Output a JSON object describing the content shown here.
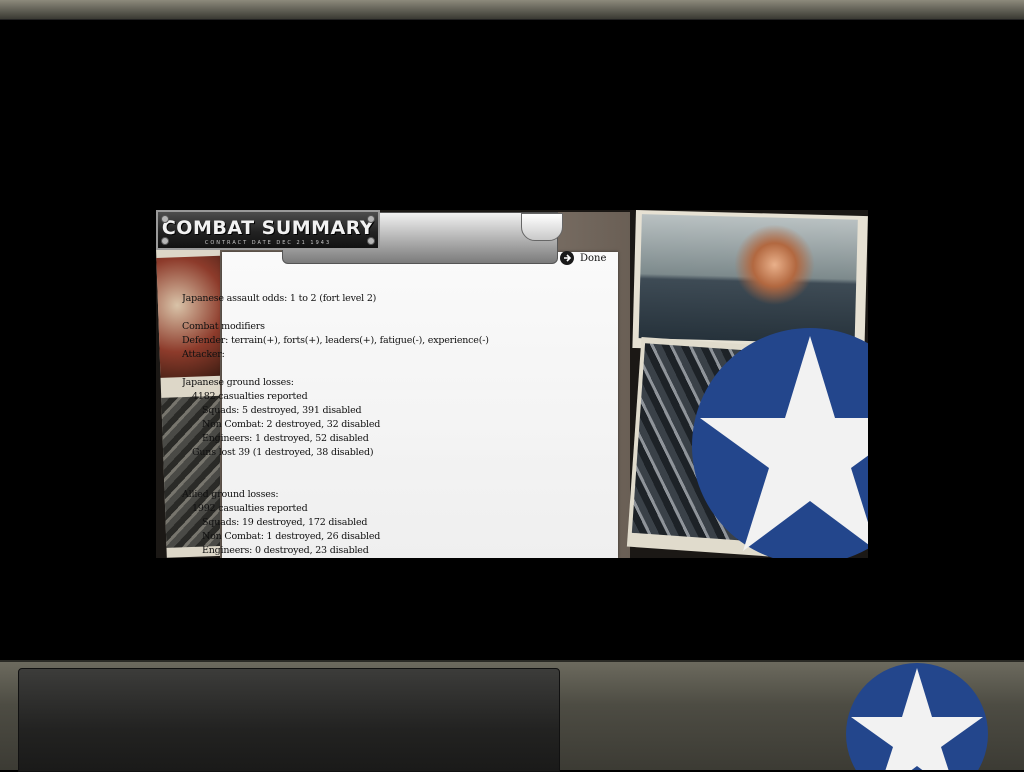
{
  "window": {
    "title": "COMBAT SUMMARY",
    "subtitle": "CONTRACT DATE  DEC  21  1943"
  },
  "toolbar": {
    "done_label": "Done",
    "done_icon": "arrow-right-circle-icon"
  },
  "report": {
    "lines": [
      {
        "text": "Japanese assault odds: 1 to 2 (fort level 2)",
        "indent": 0
      },
      {
        "text": "",
        "indent": 0
      },
      {
        "text": "Combat modifiers",
        "indent": 0
      },
      {
        "text": "Defender: terrain(+), forts(+), leaders(+), fatigue(-), experience(-)",
        "indent": 0
      },
      {
        "text": "Attacker:",
        "indent": 0
      },
      {
        "text": "",
        "indent": 0
      },
      {
        "text": "Japanese ground losses:",
        "indent": 0
      },
      {
        "text": "4182 casualties reported",
        "indent": 1
      },
      {
        "text": "Squads: 5 destroyed, 391 disabled",
        "indent": 2
      },
      {
        "text": "Non Combat: 2 destroyed, 32 disabled",
        "indent": 2
      },
      {
        "text": "Engineers: 1 destroyed, 52 disabled",
        "indent": 2
      },
      {
        "text": "Guns lost 39 (1 destroyed, 38 disabled)",
        "indent": 1
      },
      {
        "text": "",
        "indent": 0
      },
      {
        "text": "",
        "indent": 0
      },
      {
        "text": "Allied ground losses:",
        "indent": 0
      },
      {
        "text": "1992 casualties reported",
        "indent": 1
      },
      {
        "text": "Squads: 19 destroyed, 172 disabled",
        "indent": 2
      },
      {
        "text": "Non Combat: 1 destroyed, 26 disabled",
        "indent": 2
      },
      {
        "text": "Engineers: 0 destroyed, 23 disabled",
        "indent": 2
      }
    ]
  },
  "colors": {
    "roundel_blue": "#23468c",
    "roundel_white": "#f2f2f2",
    "paper": "#f4f4f4",
    "frame": "#6a5f55"
  }
}
